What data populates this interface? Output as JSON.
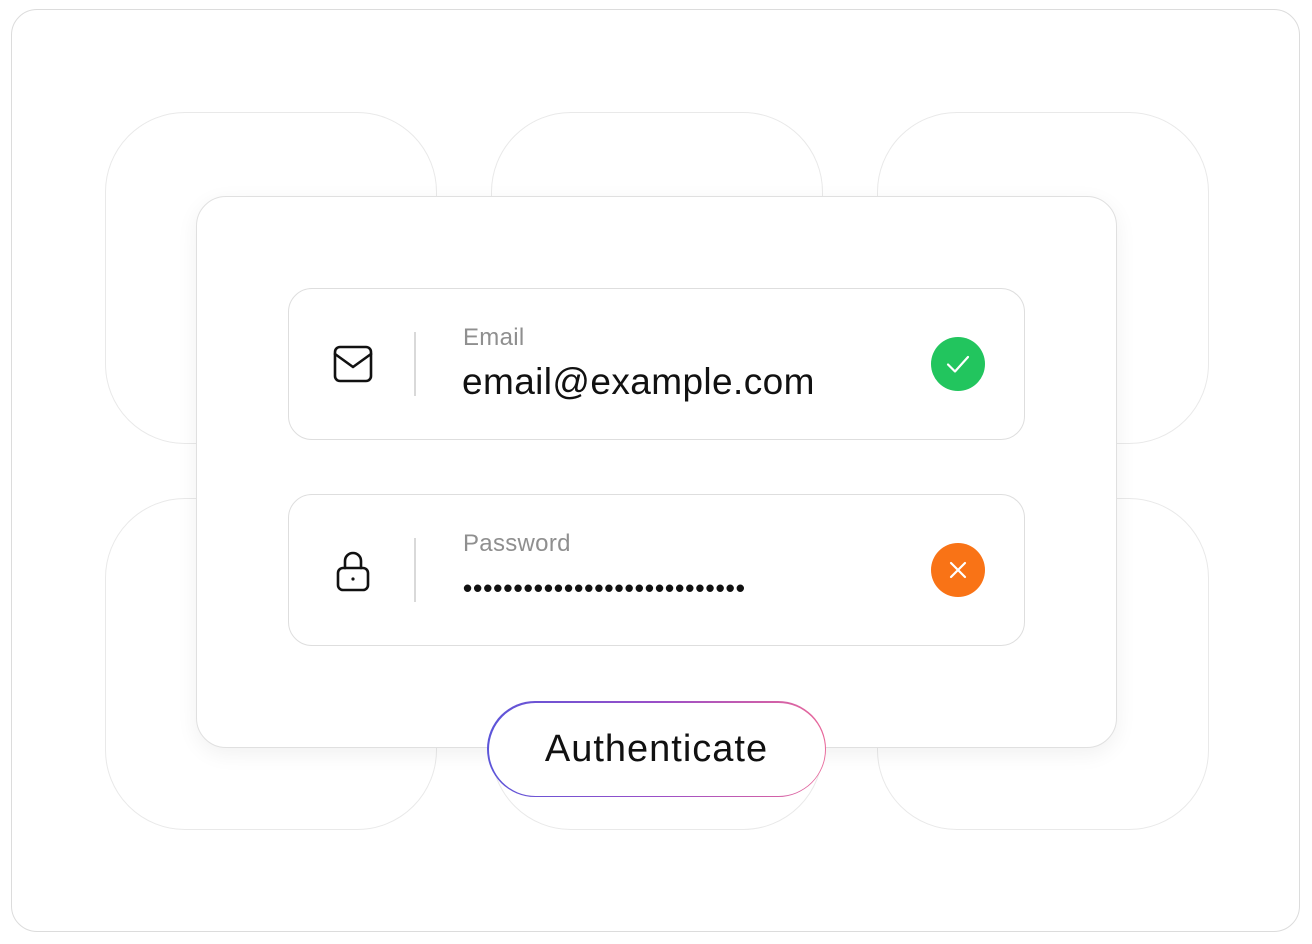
{
  "login_form": {
    "email": {
      "label": "Email",
      "value": "email@example.com",
      "icon": "envelope-icon",
      "status": "valid",
      "status_icon": "check-icon",
      "status_color": "#22c55e"
    },
    "password": {
      "label": "Password",
      "value": "••••••••••••••••••••••••••••",
      "icon": "lock-icon",
      "status": "invalid",
      "status_icon": "close-icon",
      "status_color": "#f97316"
    },
    "submit_label": "Authenticate"
  },
  "colors": {
    "button_gradient_start": "#5b55d9",
    "button_gradient_end": "#e9689a"
  }
}
